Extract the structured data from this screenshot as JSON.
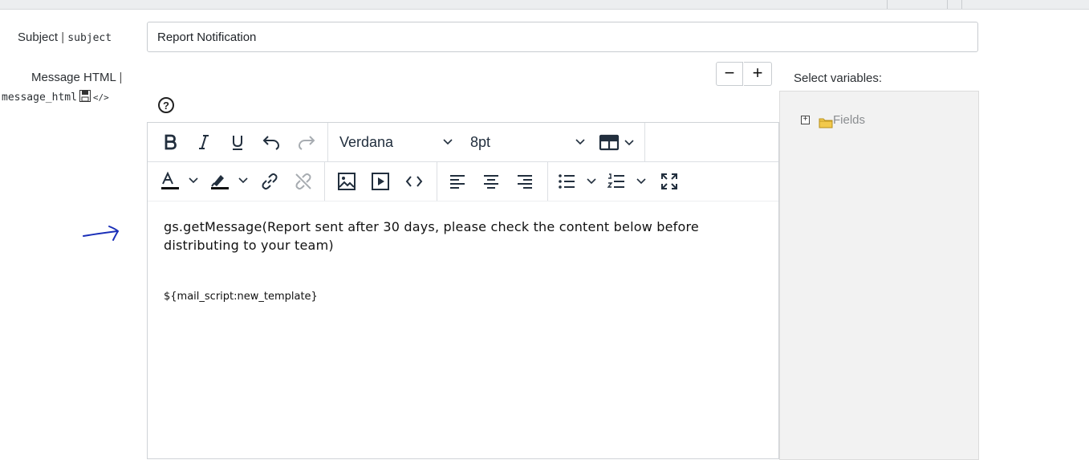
{
  "form": {
    "subject_label": "Subject",
    "subject_field": "subject",
    "subject_value": "Report Notification",
    "message_label": "Message HTML",
    "message_field": "message_html",
    "source_code_glyph": "</>"
  },
  "editor": {
    "font_family": "Verdana",
    "font_size": "8pt",
    "zoom_out": "−",
    "zoom_in": "+",
    "help_glyph": "?",
    "toolbar_row1": [
      "bold-icon",
      "italic-icon",
      "underline-icon",
      "undo-icon",
      "redo-icon",
      "font-family-select",
      "font-size-select",
      "table-icon"
    ],
    "toolbar_row2": [
      "text-color-icon",
      "highlight-color-icon",
      "link-icon",
      "unlink-icon",
      "image-icon",
      "media-icon",
      "code-icon",
      "align-left-icon",
      "align-center-icon",
      "align-right-icon",
      "bullet-list-icon",
      "numbered-list-icon",
      "fullscreen-icon"
    ],
    "body_line1": "gs.getMessage(Report sent after 30 days, please check the content below before distributing to your team)",
    "body_line2": "${mail_script:new_template}"
  },
  "variables": {
    "title": "Select variables:",
    "tree_root": "Fields"
  },
  "colors": {
    "annotation_arrow": "#1a2fb8",
    "panel_bg": "#f2f2f2",
    "icon": "#222f3e"
  }
}
